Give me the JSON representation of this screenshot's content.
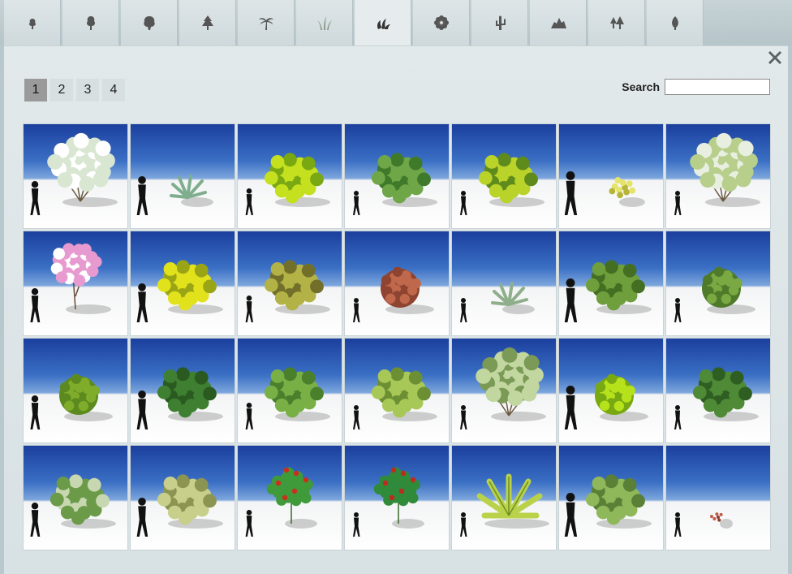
{
  "tabs": [
    {
      "icon": "small-tree-icon"
    },
    {
      "icon": "tree-icon"
    },
    {
      "icon": "broadleaf-tree-icon"
    },
    {
      "icon": "conifer-icon"
    },
    {
      "icon": "palm-tree-icon"
    },
    {
      "icon": "grass-icon"
    },
    {
      "icon": "shrub-icon",
      "active": true
    },
    {
      "icon": "flower-icon"
    },
    {
      "icon": "cactus-icon"
    },
    {
      "icon": "rock-icon"
    },
    {
      "icon": "forest-icon"
    },
    {
      "icon": "leaf-icon"
    }
  ],
  "pagination": {
    "pages": [
      "1",
      "2",
      "3",
      "4"
    ],
    "current": "1"
  },
  "search": {
    "label": "Search",
    "value": ""
  },
  "plants": [
    {
      "kind": "sparse",
      "foliage": "#d9e6d2",
      "accent": "#ffffff",
      "person": true
    },
    {
      "kind": "agave",
      "foliage": "#7fae8e",
      "accent": "#5c8a6a",
      "person": true
    },
    {
      "kind": "bush",
      "foliage": "#c4e01e",
      "accent": "#7aa812",
      "person": true
    },
    {
      "kind": "bush",
      "foliage": "#6fa648",
      "accent": "#3f7a2a",
      "person": true
    },
    {
      "kind": "bush",
      "foliage": "#b9d32a",
      "accent": "#5f8a1c",
      "person": true
    },
    {
      "kind": "small",
      "foliage": "#e4e36a",
      "accent": "#b7b43a",
      "person": true
    },
    {
      "kind": "sparse",
      "foliage": "#b8cf8c",
      "accent": "#e8efe0",
      "person": true
    },
    {
      "kind": "blossom",
      "foliage": "#e79ad0",
      "accent": "#ffffff",
      "person": true
    },
    {
      "kind": "bush",
      "foliage": "#e2e21c",
      "accent": "#9aa515",
      "person": true
    },
    {
      "kind": "bush",
      "foliage": "#b3b246",
      "accent": "#726f2a",
      "person": true
    },
    {
      "kind": "round",
      "foliage": "#c0684c",
      "accent": "#8e4430",
      "person": true
    },
    {
      "kind": "agave",
      "foliage": "#8fae8c",
      "accent": "#5e7e5c",
      "person": true
    },
    {
      "kind": "bush",
      "foliage": "#6f9e3c",
      "accent": "#446f22",
      "person": true
    },
    {
      "kind": "round",
      "foliage": "#7aa843",
      "accent": "#4f7a2a",
      "person": true
    },
    {
      "kind": "round",
      "foliage": "#7fac2a",
      "accent": "#5c8a1e",
      "person": true
    },
    {
      "kind": "bush",
      "foliage": "#3f7f32",
      "accent": "#2a5a20",
      "person": true
    },
    {
      "kind": "bush",
      "foliage": "#78b046",
      "accent": "#4a7f2c",
      "person": true
    },
    {
      "kind": "bush",
      "foliage": "#a7c757",
      "accent": "#6c8f33",
      "person": true
    },
    {
      "kind": "sparse",
      "foliage": "#c2d6a0",
      "accent": "#7a9a56",
      "person": true
    },
    {
      "kind": "round",
      "foliage": "#b6e21c",
      "accent": "#78a812",
      "person": true
    },
    {
      "kind": "bush",
      "foliage": "#4f8a36",
      "accent": "#2e5e22",
      "person": true
    },
    {
      "kind": "bush",
      "foliage": "#6b9a48",
      "accent": "#c7d7b0",
      "person": true
    },
    {
      "kind": "bush",
      "foliage": "#c8cf8a",
      "accent": "#8c9452",
      "person": true
    },
    {
      "kind": "flowering",
      "foliage": "#3f9a3a",
      "accent": "#c8301e",
      "person": true
    },
    {
      "kind": "flowering",
      "foliage": "#2f8a3a",
      "accent": "#c02a1e",
      "person": true
    },
    {
      "kind": "fern",
      "foliage": "#b9d24a",
      "accent": "#6f8f24",
      "person": true
    },
    {
      "kind": "bush",
      "foliage": "#8fb85a",
      "accent": "#5a7f36",
      "person": true
    },
    {
      "kind": "tiny",
      "foliage": "#c25a4a",
      "accent": "#8f3a2a",
      "person": true
    }
  ]
}
